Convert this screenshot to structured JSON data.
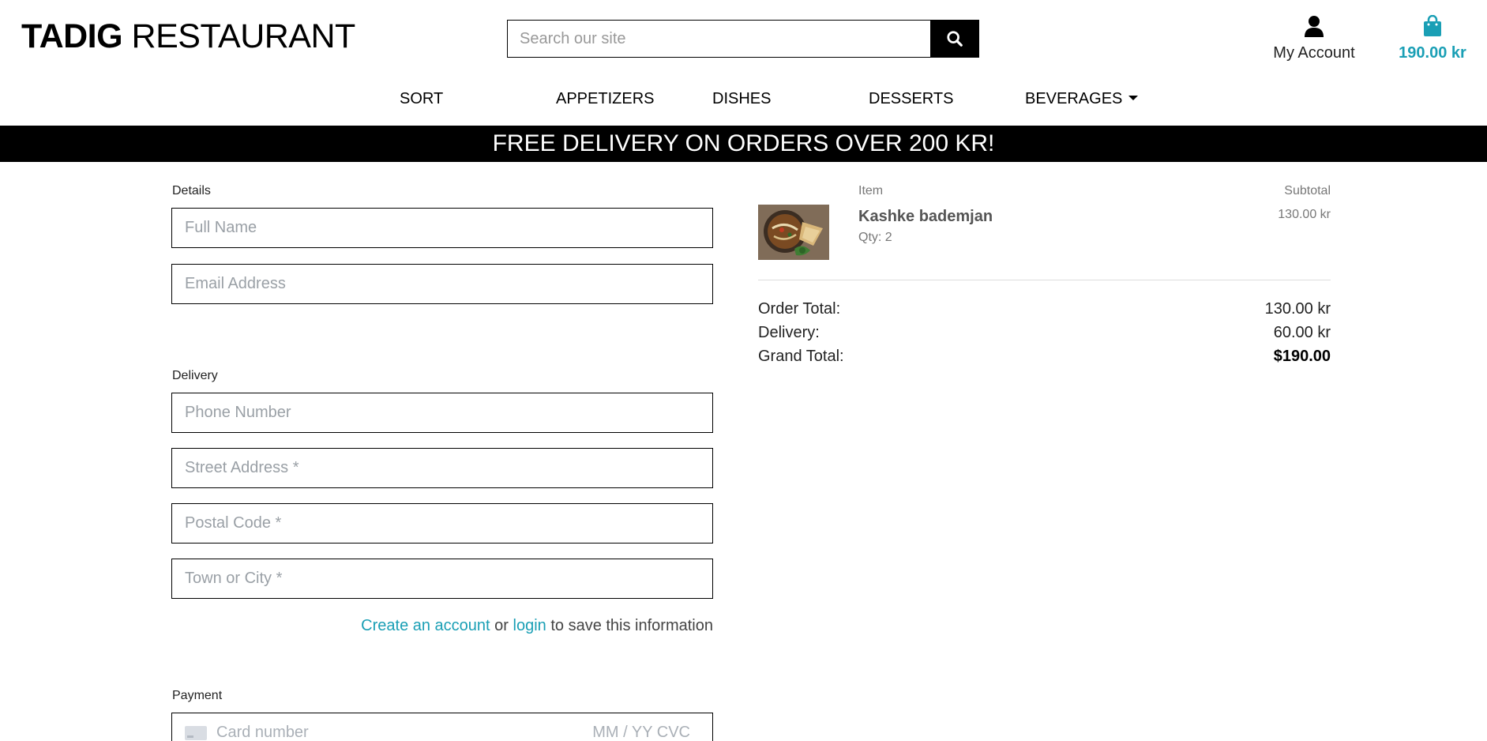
{
  "header": {
    "logo_bold": "TADIG",
    "logo_light": "RESTAURANT",
    "search_placeholder": "Search our site",
    "account_label": "My Account",
    "cart_total": "190.00 kr",
    "icons": {
      "search": "search-icon",
      "account": "user-icon",
      "cart": "shopping-bag-icon"
    }
  },
  "nav": {
    "items": [
      {
        "label": "SORT"
      },
      {
        "label": "APPETIZERS"
      },
      {
        "label": "DISHES"
      },
      {
        "label": "DESSERTS"
      },
      {
        "label": "BEVERAGES"
      }
    ]
  },
  "banner": {
    "text": "FREE DELIVERY ON ORDERS OVER 200 KR!"
  },
  "form": {
    "details_label": "Details",
    "full_name_placeholder": "Full Name",
    "email_placeholder": "Email Address",
    "delivery_label": "Delivery",
    "phone_placeholder": "Phone Number",
    "street_placeholder": "Street Address *",
    "postal_placeholder": "Postal Code *",
    "town_placeholder": "Town or City *",
    "create_account_link": "Create an account",
    "or_text": " or ",
    "login_link": "login",
    "save_suffix": " to save this information",
    "payment_label": "Payment",
    "card_placeholder": "Card number",
    "card_exp_cvc": "MM / YY  CVC"
  },
  "summary": {
    "item_header": "Item",
    "subtotal_header": "Subtotal",
    "items": [
      {
        "name": "Kashke bademjan",
        "qty": "Qty: 2",
        "subtotal": "130.00 kr"
      }
    ],
    "order_total_label": "Order Total:",
    "order_total_value": "130.00 kr",
    "delivery_label": "Delivery:",
    "delivery_value": "60.00 kr",
    "grand_total_label": "Grand Total:",
    "grand_total_value": "$190.00"
  },
  "colors": {
    "accent": "#1a9fb5",
    "banner_bg": "#000000"
  }
}
